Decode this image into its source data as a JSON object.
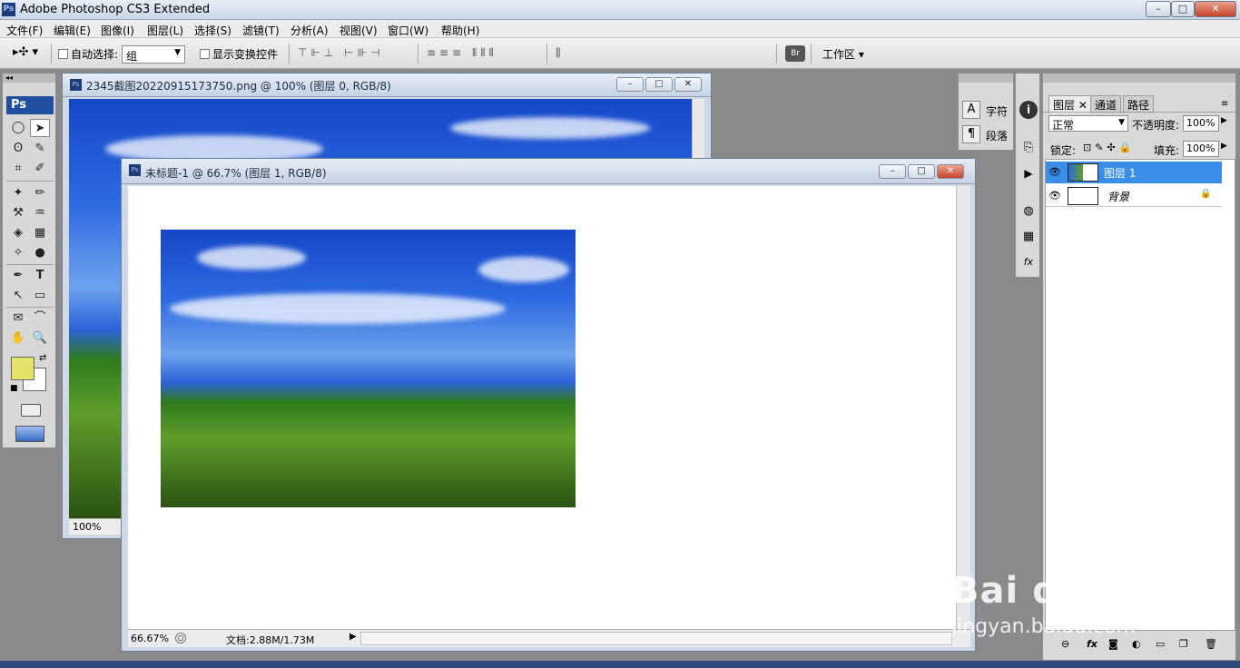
{
  "app": {
    "title": "Adobe Photoshop CS3 Extended",
    "logo": "Ps",
    "window_controls": [
      "–",
      "□",
      "✕"
    ]
  },
  "menu": [
    "文件(F)",
    "编辑(E)",
    "图像(I)",
    "图层(L)",
    "选择(S)",
    "滤镜(T)",
    "分析(A)",
    "视图(V)",
    "窗口(W)",
    "帮助(H)"
  ],
  "options": {
    "auto_select_label": "自动选择:",
    "auto_select_value": "组",
    "show_transform_label": "显示变换控件",
    "workspace_label": "工作区 ▾",
    "move_icon": "▸✣ ▾"
  },
  "toolbox": {
    "label": "Ps",
    "tools": [
      [
        "◯",
        "➤"
      ],
      [
        "ʘ",
        "✎"
      ],
      [
        "⌗",
        "✐"
      ],
      [
        "✦",
        "✏"
      ],
      [
        "⚒",
        "♒"
      ],
      [
        "◈",
        "▦"
      ],
      [
        "✧",
        "●"
      ],
      [
        "✒",
        "T"
      ],
      [
        "↖",
        "▭"
      ],
      [
        "✉",
        "⌒"
      ],
      [
        "✋",
        "🔍"
      ]
    ],
    "foreground_color": "#e6e36a",
    "background_color": "#ffffff"
  },
  "doc_back": {
    "title": "2345截图20220915173750.png @ 100% (图层 0, RGB/8)",
    "zoom": "100%"
  },
  "doc_front": {
    "title": "未标题-1 @ 66.7% (图层 1, RGB/8)",
    "zoom": "66.67%",
    "doc_info": "文档:2.88M/1.73M"
  },
  "char_panel": {
    "char_label": "字符",
    "para_label": "段落"
  },
  "layers_panel": {
    "tabs": [
      "图层 ✕",
      "通道",
      "路径"
    ],
    "blend_mode": "正常",
    "opacity_label": "不透明度:",
    "opacity_value": "100%",
    "lock_label": "锁定:",
    "fill_label": "填充:",
    "fill_value": "100%",
    "layers": [
      {
        "name": "图层 1",
        "selected": true
      },
      {
        "name": "背景",
        "selected": false
      }
    ],
    "footer_icons": [
      "⊖",
      "fx",
      "◙",
      "◐",
      "▭",
      "❐",
      "🗑"
    ]
  },
  "watermark": {
    "brand": "Bai du 经验",
    "url": "jingyan.baidu.com"
  }
}
